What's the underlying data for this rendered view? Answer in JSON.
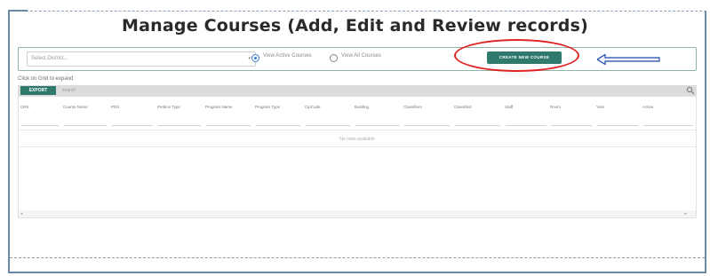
{
  "page": {
    "title": "Manage Courses (Add, Edit and Review records)"
  },
  "filters": {
    "district_placeholder": "Select District...",
    "radio_active": "View Active Courses",
    "radio_all": "View All Courses",
    "selected_view": "active",
    "create_button": "CREATE NEW COURSE"
  },
  "grid": {
    "hint": "Click on Grid to expand",
    "export_label": "EXPORT",
    "search_label": "search",
    "columns": [
      "CRS",
      "Course Name",
      "PDS",
      "Perkins Type",
      "Program Name",
      "Program Type",
      "CipCode",
      "Building",
      "Classifiers",
      "Classified",
      "Staff",
      "Room",
      "Year",
      "Active"
    ],
    "no_rows": "No rows available"
  },
  "colors": {
    "accent": "#2f7a6d",
    "highlight": "#e02424",
    "arrow": "#1f4aa8"
  }
}
